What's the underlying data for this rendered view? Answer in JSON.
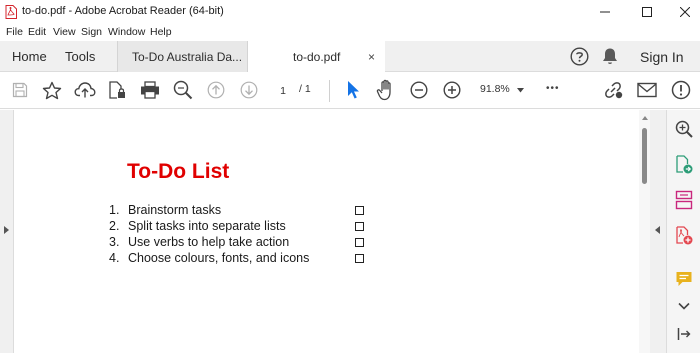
{
  "window": {
    "title": "to-do.pdf - Adobe Acrobat Reader (64-bit)",
    "icon": "pdf-file-icon"
  },
  "menu": {
    "items": [
      {
        "label": "File"
      },
      {
        "label": "Edit"
      },
      {
        "label": "View"
      },
      {
        "label": "Sign"
      },
      {
        "label": "Window"
      },
      {
        "label": "Help"
      }
    ]
  },
  "tabs": {
    "home": "Home",
    "tools": "Tools",
    "documents": [
      {
        "label": "To-Do Australia Da...",
        "active": false
      },
      {
        "label": "to-do.pdf",
        "active": true
      }
    ],
    "close": "×",
    "sign_in": "Sign In"
  },
  "toolbar": {
    "current_page": "1",
    "page_separator": "/ 1",
    "zoom": "91.8%",
    "more": "•••"
  },
  "document": {
    "title": "To-Do List",
    "items": [
      {
        "num": "1.",
        "text": "Brainstorm tasks"
      },
      {
        "num": "2.",
        "text": "Split tasks into separate lists"
      },
      {
        "num": "3.",
        "text": "Use verbs to help take action"
      },
      {
        "num": "4.",
        "text": "Choose colours, fonts, and icons"
      }
    ]
  },
  "colors": {
    "doc_title": "#e00000",
    "accent_blue": "#1473e6",
    "export_green": "#2d9d78",
    "organize_pink": "#c9267d",
    "pdf_red": "#e34850",
    "comment_yellow": "#e8b21e"
  }
}
